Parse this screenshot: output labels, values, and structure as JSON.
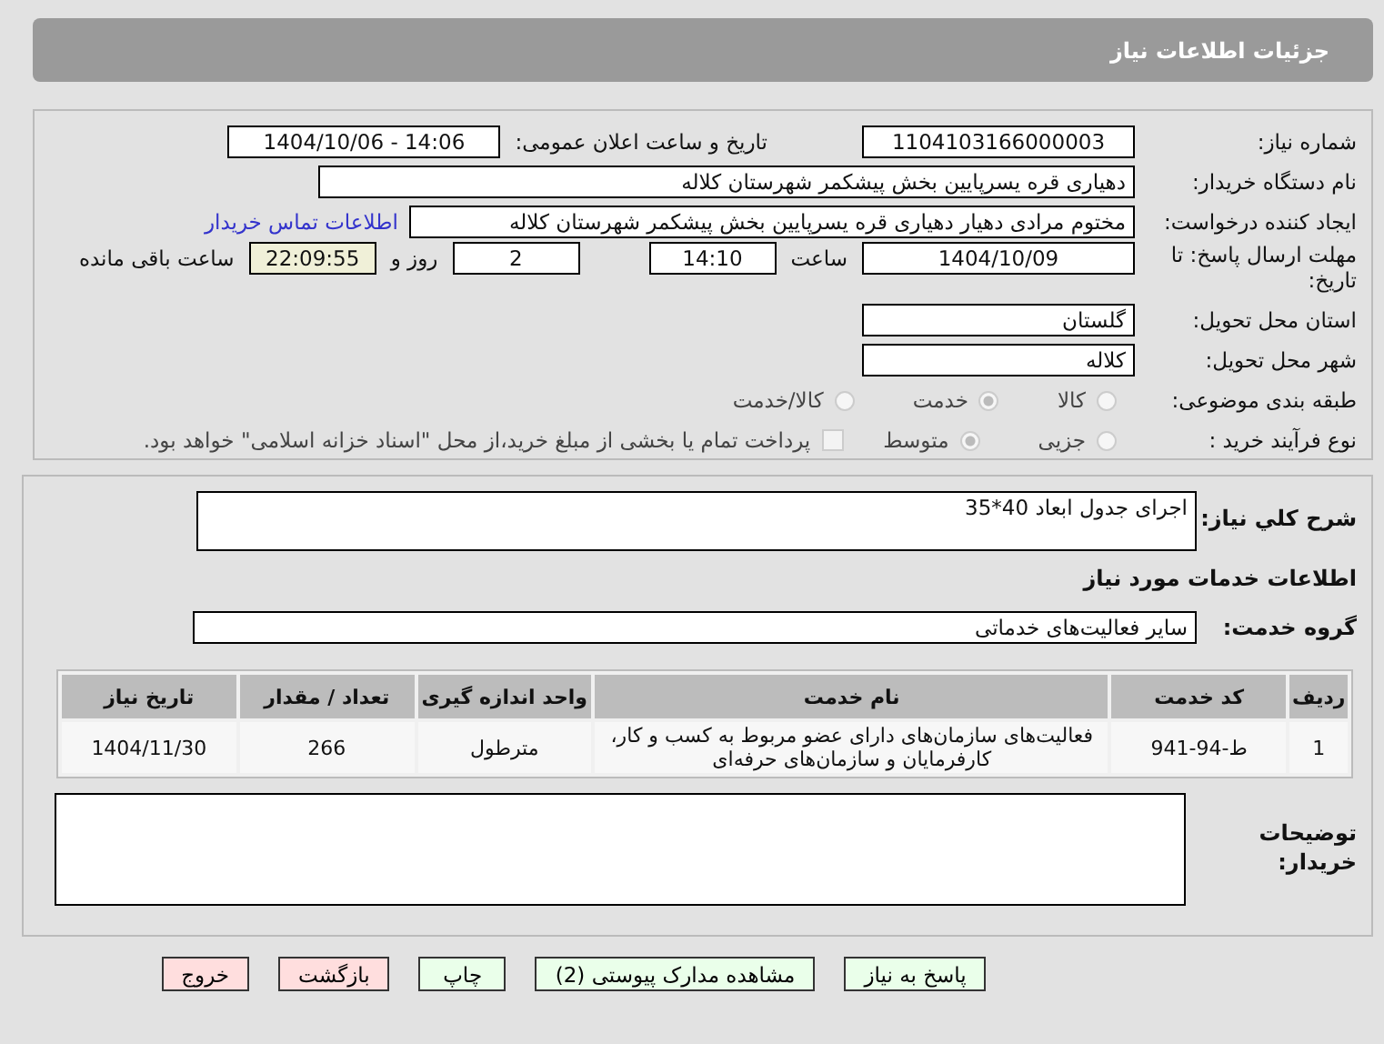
{
  "header": {
    "title": "جزئیات اطلاعات نیاز"
  },
  "need_number": {
    "label": "شماره نیاز:",
    "value": "1104103166000003"
  },
  "announce": {
    "label": "تاریخ و ساعت اعلان عمومی:",
    "value": "1404/10/06 - 14:06"
  },
  "buyer": {
    "label": "نام دستگاه خریدار:",
    "value": "دهیاری قره یسرپایین بخش پیشکمر شهرستان کلاله"
  },
  "creator": {
    "label": "ایجاد کننده درخواست:",
    "value": "مختوم مرادی دهیار دهیاری قره یسرپایین بخش پیشکمر شهرستان کلاله",
    "link": "اطلاعات تماس خریدار"
  },
  "deadline": {
    "label": "مهلت ارسال پاسخ: تا تاریخ:",
    "date": "1404/10/09",
    "time_label": "ساعت",
    "time": "14:10",
    "days": "2",
    "days_label": "روز و",
    "remaining": "22:09:55",
    "remaining_label": "ساعت باقی مانده"
  },
  "province": {
    "label": "استان محل تحویل:",
    "value": "گلستان"
  },
  "city": {
    "label": "شهر محل تحویل:",
    "value": "کلاله"
  },
  "category": {
    "label": "طبقه بندی موضوعی:",
    "options": [
      {
        "label": "کالا",
        "selected": false
      },
      {
        "label": "خدمت",
        "selected": true
      },
      {
        "label": "کالا/خدمت",
        "selected": false
      }
    ]
  },
  "purchase_type": {
    "label": "نوع فرآیند خرید :",
    "options": [
      {
        "label": "جزیی",
        "selected": false
      },
      {
        "label": "متوسط",
        "selected": true
      }
    ],
    "checkbox": {
      "label": "پرداخت تمام یا بخشی از مبلغ خرید،از محل \"اسناد خزانه اسلامی\" خواهد بود.",
      "checked": false
    }
  },
  "description": {
    "label": "شرح کلي نياز:",
    "value": "اجرای جدول ابعاد 40*35"
  },
  "services_title": "اطلاعات خدمات مورد نیاز",
  "service_group": {
    "label": "گروه خدمت:",
    "value": "سایر فعالیت‌های خدماتی"
  },
  "table": {
    "columns": [
      "ردیف",
      "کد خدمت",
      "نام خدمت",
      "واحد اندازه گیری",
      "تعداد / مقدار",
      "تاریخ نیاز"
    ],
    "rows": [
      [
        "1",
        "ط-94-941",
        "فعالیت‌های سازمان‌های دارای عضو مربوط به کسب و کار، کارفرمایان و سازمان‌های حرفه‌ای",
        "مترطول",
        "266",
        "1404/11/30"
      ]
    ]
  },
  "buyer_notes": {
    "label": "توضیحات خریدار:"
  },
  "buttons": [
    {
      "label": "پاسخ به نیاز",
      "color": "#eaffea"
    },
    {
      "label": "مشاهده مدارک پیوستی (2)",
      "color": "#eaffea"
    },
    {
      "label": "چاپ",
      "color": "#eaffea"
    },
    {
      "label": "بازگشت",
      "color": "#ffdede"
    },
    {
      "label": "خروج",
      "color": "#ffdede"
    }
  ]
}
